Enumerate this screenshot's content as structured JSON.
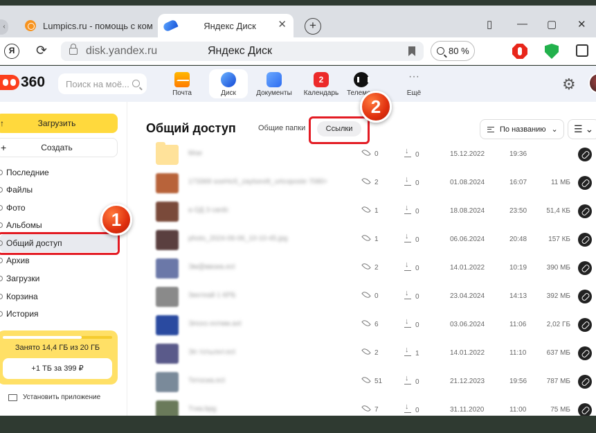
{
  "browser": {
    "tabs": [
      {
        "title": "Lumpics.ru - помощь с ком",
        "active": false
      },
      {
        "title": "Яндекс Диск",
        "active": true
      }
    ],
    "ya_glyph": "Я",
    "url": "disk.yandex.ru",
    "page_title": "Яндекс Диск",
    "zoom": "80 %"
  },
  "header": {
    "logo_text": "360",
    "search_placeholder": "Поиск на моё...",
    "services": [
      {
        "label": "Почта",
        "icon": "mail-icon"
      },
      {
        "label": "Диск",
        "icon": "disk-icon",
        "active": true
      },
      {
        "label": "Документы",
        "icon": "documents-icon"
      },
      {
        "label": "Календарь",
        "icon": "calendar-icon",
        "badge": "2"
      },
      {
        "label": "Телемост",
        "icon": "telemost-icon"
      },
      {
        "label": "Ещё",
        "icon": "more-icon"
      }
    ]
  },
  "sidebar": {
    "upload_label": "Загрузить",
    "create_label": "Создать",
    "items": [
      {
        "label": "Последние"
      },
      {
        "label": "Файлы"
      },
      {
        "label": "Фото"
      },
      {
        "label": "Альбомы"
      },
      {
        "label": "Общий доступ",
        "active": true
      },
      {
        "label": "Архив"
      },
      {
        "label": "Загрузки"
      },
      {
        "label": "Корзина"
      },
      {
        "label": "История"
      }
    ],
    "storage": {
      "text": "Занято 14,4 ГБ из 20 ГБ",
      "used_fraction": 0.72,
      "button": "+1 ТБ за 399 ₽"
    },
    "install_label": "Установить приложение"
  },
  "main": {
    "title": "Общий доступ",
    "subtabs": {
      "folders": "Общие папки",
      "links": "Ссылки"
    },
    "sort_label": "По названию",
    "rows": [
      {
        "name": "Мои",
        "views": "0",
        "downloads": "0",
        "date": "15.12.2022",
        "time": "19:36",
        "size": "",
        "thumb": "folder"
      },
      {
        "name": "173369 soeHoS_zaytsevitt_urtcoposte 7080×4320.jpg",
        "views": "2",
        "downloads": "0",
        "date": "01.08.2024",
        "time": "16:07",
        "size": "11 МБ",
        "thumb": "#b8633a"
      },
      {
        "name": "a ОД 3 cardc",
        "views": "1",
        "downloads": "0",
        "date": "18.08.2024",
        "time": "23:50",
        "size": "51,4 КБ",
        "thumb": "#7a4a3a"
      },
      {
        "name": "photo_2024-06-06_10-10-45.jpg",
        "views": "1",
        "downloads": "0",
        "date": "06.06.2024",
        "time": "20:48",
        "size": "157 КБ",
        "thumb": "#5a3f3f"
      },
      {
        "name": "Эм@ввоиа.eсt",
        "views": "2",
        "downloads": "0",
        "date": "14.01.2022",
        "time": "10:19",
        "size": "390 МБ",
        "thumb": "#6b78a8"
      },
      {
        "name": "Зинтеай 1 КРБ",
        "views": "0",
        "downloads": "0",
        "date": "23.04.2024",
        "time": "14:13",
        "size": "392 МБ",
        "thumb": "#8a8a8a"
      },
      {
        "name": "Элохэ еотмм.axt",
        "views": "6",
        "downloads": "0",
        "date": "03.06.2024",
        "time": "11:06",
        "size": "2,02 ГБ",
        "thumb": "#2a4aa0"
      },
      {
        "name": "Эп тотылнт.eсt",
        "views": "2",
        "downloads": "1",
        "date": "14.01.2022",
        "time": "11:10",
        "size": "637 МБ",
        "thumb": "#5a5a8a"
      },
      {
        "name": "Тетосиа.eсt",
        "views": "51",
        "downloads": "0",
        "date": "21.12.2023",
        "time": "19:56",
        "size": "787 МБ",
        "thumb": "#7a8a9a"
      },
      {
        "name": "Тгиа.bpg",
        "views": "7",
        "downloads": "0",
        "date": "31.11.2020",
        "time": "11:00",
        "size": "75 МБ",
        "thumb": "#6a7a5a"
      }
    ]
  },
  "annotations": [
    {
      "number": "1"
    },
    {
      "number": "2"
    }
  ],
  "colors": {
    "accent_yellow": "#ffd93d",
    "callout_red": "#e31b23",
    "marker_orange": "#e0300e"
  }
}
